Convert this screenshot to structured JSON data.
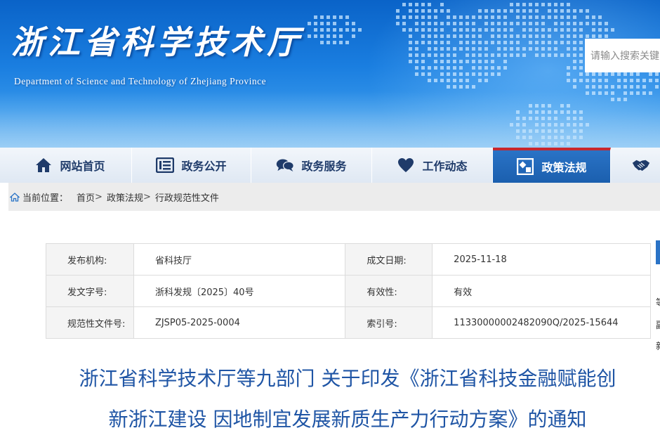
{
  "header": {
    "site_title_cn": "浙江省科学技术厅",
    "site_title_en": "Department of Science and Technology of Zhejiang Province",
    "search_placeholder": "请输入搜索关键"
  },
  "nav": {
    "items": [
      {
        "label": "网站首页",
        "icon": "home-icon"
      },
      {
        "label": "政务公开",
        "icon": "list-icon"
      },
      {
        "label": "政务服务",
        "icon": "chat-bubbles-icon"
      },
      {
        "label": "工作动态",
        "icon": "heart-icon"
      },
      {
        "label": "政策法规",
        "icon": "policy-icon",
        "active": true
      },
      {
        "label": "",
        "icon": "handshake-icon"
      }
    ]
  },
  "breadcrumb": {
    "prefix": "当前位置：",
    "items": [
      "首页",
      "政策法规",
      "行政规范性文件"
    ],
    "separator": ">"
  },
  "meta": {
    "rows": [
      {
        "k1": "发布机构:",
        "v1": "省科技厅",
        "k2": "成文日期:",
        "v2": "2025-11-18"
      },
      {
        "k1": "发文字号:",
        "v1": "浙科发规〔2025〕40号",
        "k2": "有效性:",
        "v2": "有效"
      },
      {
        "k1": "规范性文件号:",
        "v1": "ZJSP05-2025-0004",
        "k2": "索引号:",
        "v2": "11330000002482090Q/2025-15644"
      }
    ]
  },
  "side_fragments": [
    "等",
    "副",
    "新"
  ],
  "article": {
    "title_line1": "浙江省科学技术厅等九部门 关于印发《浙江省科技金融赋能创",
    "title_line2": "新浙江建设 因地制宜发展新质生产力行动方案》的通知"
  },
  "colors": {
    "nav_active": "#2a73c6",
    "nav_active_top": "#c8272d",
    "title_blue": "#1f55a5",
    "nav_text": "#1f3b6a"
  }
}
